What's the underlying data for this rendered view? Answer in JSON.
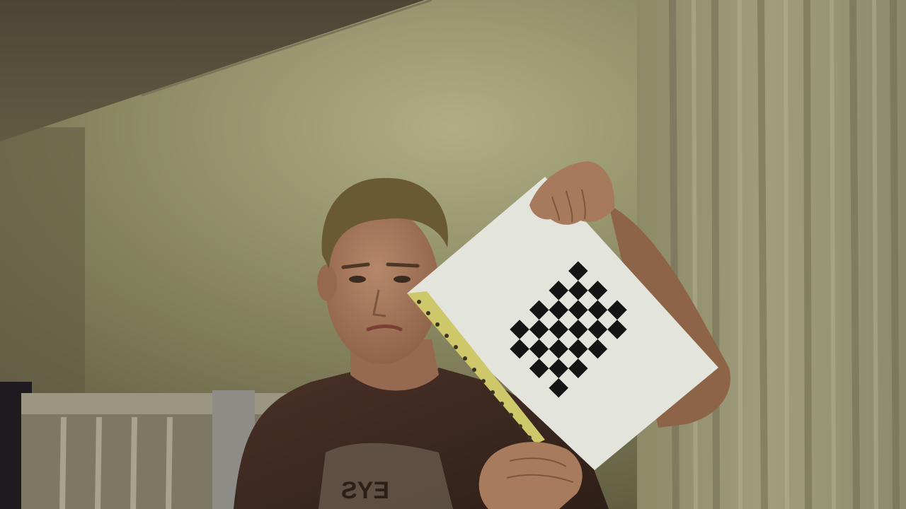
{
  "photo": {
    "subject": "person-holding-checkerboard-calibration-sheet",
    "shirt_print": "EYS",
    "board": {
      "rows": 8,
      "cols": 6,
      "pattern": "checkerboard",
      "color_dark": "#141414",
      "color_paper": "#e3e4dc"
    },
    "colors": {
      "wall": "#8b8a64",
      "ceiling": "#504b3a",
      "curtain": "#8f8d70",
      "shirt": "#3f2b22",
      "skin": "#a6765a",
      "hair": "#6a5a32",
      "filing_strip": "#cfc86a",
      "headboard": "#868270"
    }
  }
}
